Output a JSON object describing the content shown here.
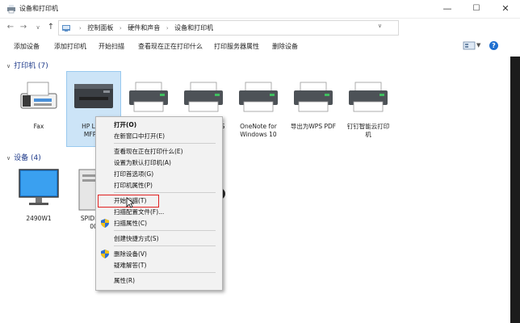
{
  "window": {
    "title": "设备和打印机",
    "buttons": {
      "min": "—",
      "max": "☐",
      "close": "✕"
    }
  },
  "address": {
    "crumbs": [
      "控制面板",
      "硬件和声音",
      "设备和打印机"
    ],
    "separator": "›",
    "search_placeholder": "搜索\"设备和打印机\""
  },
  "toolbar": {
    "add_device": "添加设备",
    "add_printer": "添加打印机",
    "start_scan": "开始扫描",
    "see_printing": "查看现在正在打印什么",
    "print_server": "打印服务器属性",
    "remove_device": "删除设备",
    "help": "?"
  },
  "printers_header": "打印机 (7)",
  "devices_header": "设备 (4)",
  "printers": [
    {
      "line1": "Fax",
      "line2": ""
    },
    {
      "line1": "HP Lase",
      "line2": "MFP M"
    },
    {
      "line1": "",
      "line2": ""
    },
    {
      "line1": "S",
      "line2": ""
    },
    {
      "line1": "OneNote for",
      "line2": "Windows 10"
    },
    {
      "line1": "导出为WPS PDF",
      "line2": ""
    },
    {
      "line1": "钉钉智能云打印",
      "line2": "机"
    }
  ],
  "devices": [
    {
      "line1": "2490W1",
      "line2": ""
    },
    {
      "line1": "SPIDERX",
      "line2": "00"
    },
    {
      "line1": "L",
      "line2": ""
    }
  ],
  "context_menu": {
    "open": "打开(O)",
    "open_new_window": "在新窗口中打开(E)",
    "see_printing": "查看现在正在打印什么(E)",
    "set_default": "设置为默认打印机(A)",
    "print_prefs": "打印首选项(G)",
    "printer_props": "打印机属性(P)",
    "start_scan": "开始扫描(T)",
    "scan_profiles": "扫描配置文件(F)...",
    "scan_props": "扫描属性(C)",
    "create_shortcut": "创建快捷方式(S)",
    "remove_device": "删除设备(V)",
    "troubleshoot": "疑难解答(T)",
    "properties": "属性(R)"
  },
  "colors": {
    "accent": "#1f6fcf",
    "header_blue": "#1e3a8a",
    "highlight_red": "#e02020",
    "selection": "#cce4f7"
  }
}
